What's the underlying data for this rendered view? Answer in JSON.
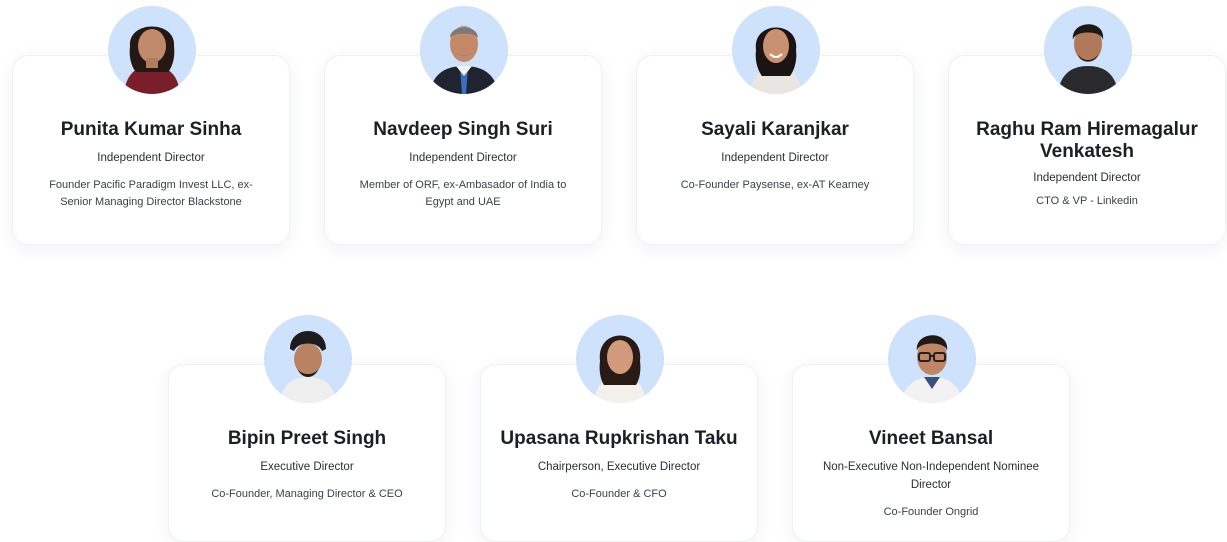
{
  "colors": {
    "avatar_bg": "#cfe2fb",
    "card_bg": "#ffffff",
    "text_primary": "#1c1f26"
  },
  "directors": [
    {
      "name": "Punita Kumar Sinha",
      "role": "Independent Director",
      "description": "Founder Pacific Paradigm Invest LLC, ex-Senior Managing Director Blackstone",
      "avatar_icon": "person-portrait-icon"
    },
    {
      "name": "Navdeep Singh Suri",
      "role": "Independent Director",
      "description": "Member of ORF, ex-Ambasador of India to Egypt and UAE",
      "avatar_icon": "person-portrait-icon"
    },
    {
      "name": "Sayali Karanjkar",
      "role": "Independent Director",
      "description": "Co-Founder Paysense, ex-AT Kearney",
      "avatar_icon": "person-portrait-icon"
    },
    {
      "name": "Raghu Ram Hiremagalur Venkatesh",
      "role": "Independent Director",
      "description": "CTO & VP - Linkedin",
      "avatar_icon": "person-portrait-icon"
    },
    {
      "name": "Bipin Preet Singh",
      "role": "Executive Director",
      "description": "Co-Founder, Managing Director & CEO",
      "avatar_icon": "person-portrait-icon"
    },
    {
      "name": "Upasana Rupkrishan Taku",
      "role": "Chairperson, Executive Director",
      "description": "Co-Founder & CFO",
      "avatar_icon": "person-portrait-icon"
    },
    {
      "name": "Vineet Bansal",
      "role": "Non-Executive Non-Independent Nominee Director",
      "description": "Co-Founder Ongrid",
      "avatar_icon": "person-portrait-icon"
    }
  ]
}
